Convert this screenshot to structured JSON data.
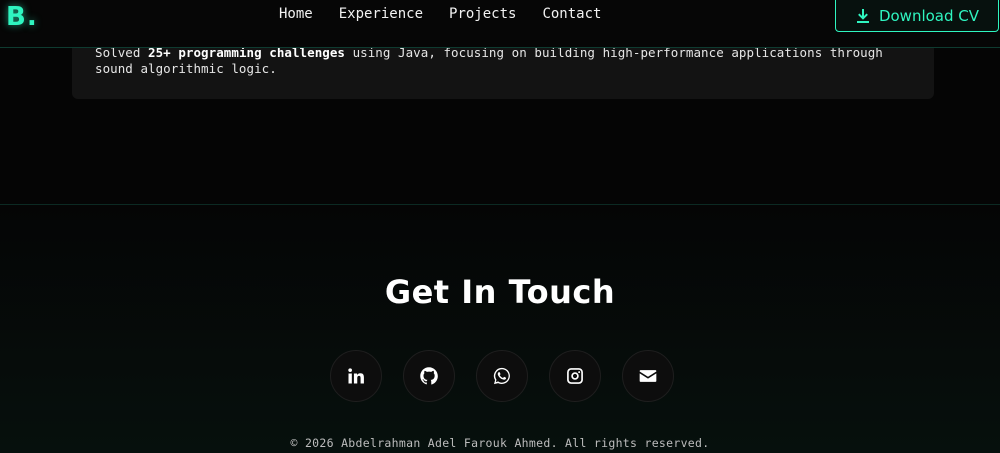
{
  "header": {
    "logo_letter": "B",
    "logo_dot": ".",
    "nav": [
      "Home",
      "Experience",
      "Projects",
      "Contact"
    ],
    "download_label": "Download CV"
  },
  "experience_card": {
    "text_before": "Solved ",
    "text_bold": "25+ programming challenges",
    "text_after": " using Java, focusing on building high-performance applications through sound algorithmic logic."
  },
  "contact": {
    "title": "Get In Touch",
    "socials": [
      "linkedin-icon",
      "github-icon",
      "whatsapp-icon",
      "instagram-icon",
      "envelope-icon"
    ]
  },
  "footer": {
    "copyright": "© 2026 Abdelrahman Adel Farouk Ahmed. All rights reserved."
  },
  "colors": {
    "accent": "#2ff5c0",
    "background": "#050505",
    "card": "#131313"
  }
}
